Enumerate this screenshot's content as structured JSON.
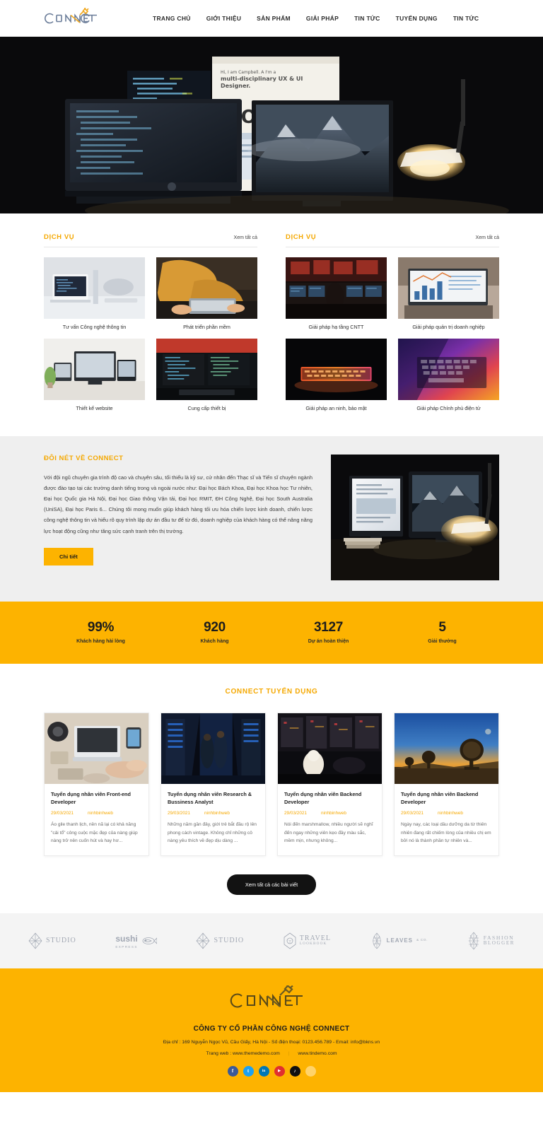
{
  "brand": {
    "name": "CONNECT",
    "accent": "#f5a800",
    "yellow": "#fdb300"
  },
  "nav": {
    "items": [
      {
        "label": "TRANG CHỦ"
      },
      {
        "label": "GIỚI THIỆU"
      },
      {
        "label": "SẢN PHẨM"
      },
      {
        "label": "GIẢI PHÁP"
      },
      {
        "label": "TIN TỨC"
      },
      {
        "label": "TUYỂN DỤNG"
      },
      {
        "label": "TIN TỨC"
      }
    ]
  },
  "services_left": {
    "title": "DỊCH VỤ",
    "more": "Xem tất cả",
    "items": [
      {
        "caption": "Tư vấn Công nghệ thông tin"
      },
      {
        "caption": "Phát triển phần mềm"
      },
      {
        "caption": "Thiết kế website"
      },
      {
        "caption": "Cung cấp thiết bị"
      }
    ]
  },
  "services_right": {
    "title": "DỊCH VỤ",
    "more": "Xem tất cả",
    "items": [
      {
        "caption": "Giải pháp hạ tầng CNTT"
      },
      {
        "caption": "Giải pháp quản trị doanh nghiệp"
      },
      {
        "caption": "Giải pháp an ninh, bảo mật"
      },
      {
        "caption": "Giải pháp Chính phủ điện tử"
      }
    ]
  },
  "about": {
    "title": "ĐÔI NÉT VỀ CONNECT",
    "body": "Với đội ngũ chuyên gia trình độ cao và chuyên sâu, tối thiểu là kỹ sư, cử nhân đến Thạc sĩ và Tiến sĩ chuyên ngành được đào tạo tại các trường danh tiếng trong và ngoài nước như: Đại học Bách Khoa, Đại học Khoa học Tư nhiên, Đại học Quốc gia Hà Nội, Đại học Giao thông Vận tải, Đại học RMIT, ĐH Công Nghệ, Đại học South Australia (UniSA), Đại học Paris 6... Chúng tôi mong muốn giúp khách hàng tối ưu hóa chiến lược kinh doanh, chiến lược công nghệ thông tin và hiểu rõ quy trình lập dự án đầu tư để từ đó, doanh nghiệp của khách hàng có thể nâng năng lực hoạt động cũng như tăng sức cạnh tranh trên thị trường.",
    "button": "Chi tiết"
  },
  "stats": {
    "items": [
      {
        "value": "99%",
        "label": "Khách hàng hài lòng"
      },
      {
        "value": "920",
        "label": "Khách hàng"
      },
      {
        "value": "3127",
        "label": "Dự án hoàn thiện"
      },
      {
        "value": "5",
        "label": "Giải thưởng"
      }
    ]
  },
  "recruit": {
    "title": "CONNECT TUYỂN DỤNG",
    "view_all": "Xem tất cả các bài viết",
    "cards": [
      {
        "title": "Tuyển dụng nhân viên Front-end Developer",
        "date": "29/03/2021",
        "author": "ninhbinhweb",
        "excerpt": "Áo gile thanh lịch, nền nã lại có khả năng \"cải tổ\" công cuộc mặc đẹp của nàng giúp nàng trở nên cuốn hút và hay hơ..."
      },
      {
        "title": "Tuyển dụng nhân viên Research & Bussiness Analyst",
        "date": "29/03/2021",
        "author": "ninhbinhweb",
        "excerpt": "Những năm gần đây, giới trẻ bắt đầu rộ lên phong cách vintage. Không chỉ những cô nàng yêu thích về đẹp dịu dàng ..."
      },
      {
        "title": "Tuyển dụng nhân viên Backend Developer",
        "date": "29/03/2021",
        "author": "ninhbinhweb",
        "excerpt": "Nói đến marshmallow, nhiều người sẽ nghĩ đến ngay những viên kẹo đầy màu sắc, mềm mịn, nhưng không..."
      },
      {
        "title": "Tuyển dụng nhân viên Backend Developer",
        "date": "29/03/2021",
        "author": "ninhbinhweb",
        "excerpt": "Ngày nay, các loại dầu dưỡng da từ thiên nhiên đang rất chiếm lòng của nhiều chị em bởi nó là thành phần tự nhiên và..."
      }
    ]
  },
  "partners": {
    "items": [
      {
        "name": "STUDIO",
        "sub": "",
        "kind": "studio",
        "icon": "diamond-lattice-icon"
      },
      {
        "name": "sushi",
        "sub": "EXPRESS",
        "kind": "sushi",
        "icon": "fish-icon"
      },
      {
        "name": "STUDIO",
        "sub": "",
        "kind": "studio",
        "icon": "diamond-lattice-icon"
      },
      {
        "name": "TRAVEL",
        "sub": "LOOKBOOK",
        "kind": "travel",
        "icon": "hexagon-t-icon"
      },
      {
        "name": "LEAVES",
        "sub": "& CO.",
        "kind": "leaves",
        "icon": "leaf-icon"
      },
      {
        "name": "FASHION",
        "sub": "BLOGGER",
        "kind": "fashion",
        "icon": "diamond-lattice-icon"
      }
    ]
  },
  "footer": {
    "company": "CÔNG TY CỔ PHẦN CÔNG NGHỆ CONNECT",
    "address_line": "Địa chỉ : 169 Nguyễn Ngọc Vũ, Cầu Giấy, Hà Nội - Số điện thoại: 0123.456.789 - Email: info@bkns.vn",
    "web_label": "Trang web : www.themedemo.com",
    "web_label2": "www.tindemo.com",
    "socials": [
      {
        "name": "facebook",
        "glyph": "f",
        "color": "#3b5998"
      },
      {
        "name": "twitter",
        "glyph": "t",
        "color": "#1da1f2"
      },
      {
        "name": "linkedin",
        "glyph": "in",
        "color": "#0077b5"
      },
      {
        "name": "youtube",
        "glyph": "▶",
        "color": "#e02f2f"
      },
      {
        "name": "tiktok",
        "glyph": "♪",
        "color": "#101010"
      },
      {
        "name": "light",
        "glyph": "",
        "color": "#ffd36a"
      }
    ]
  }
}
